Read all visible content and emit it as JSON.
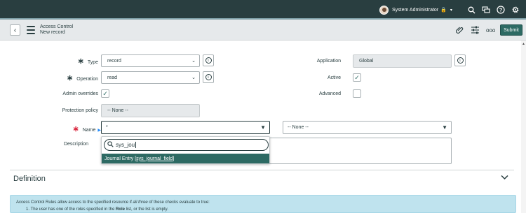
{
  "topbar": {
    "user_name": "System Administrator",
    "icons": [
      "avatar",
      "lock-icon",
      "chevron-down-icon",
      "search-icon",
      "chat-icon",
      "help-icon",
      "gear-icon"
    ]
  },
  "header": {
    "title": "Access Control",
    "subtitle": "New record",
    "submit_label": "Submit",
    "icons": [
      "back-icon",
      "hamburger-icon",
      "attachment-icon",
      "settings-sliders-icon",
      "more-icon"
    ]
  },
  "form": {
    "type_label": "Type",
    "type_value": "record",
    "operation_label": "Operation",
    "operation_value": "read",
    "admin_overrides_label": "Admin overrides",
    "admin_overrides_checked": true,
    "protection_policy_label": "Protection policy",
    "protection_policy_value": "-- None --",
    "name_label": "Name",
    "name_value": "*",
    "name_field_value": "-- None --",
    "description_label": "Description",
    "application_label": "Application",
    "application_value": "Global",
    "active_label": "Active",
    "active_checked": true,
    "advanced_label": "Advanced",
    "advanced_checked": false
  },
  "dropdown": {
    "search_value": "sys_jou",
    "result_label": "Journal Entry",
    "result_table": "sys_journal_field"
  },
  "definition": {
    "heading": "Definition",
    "intro_prefix": "Access Control Rules allow access to the specified resource if ",
    "intro_emphasis": "all three",
    "intro_suffix": " of these checks evaluate to true:",
    "item1_prefix": "1. The user has one of the roles specified in the ",
    "item1_bold": "Role",
    "item1_suffix": " list, or the list is empty."
  },
  "colors": {
    "topbar": "#293e40",
    "accent": "#2d6a63",
    "required": "#d9243c",
    "info_panel": "#bfe3ee"
  }
}
